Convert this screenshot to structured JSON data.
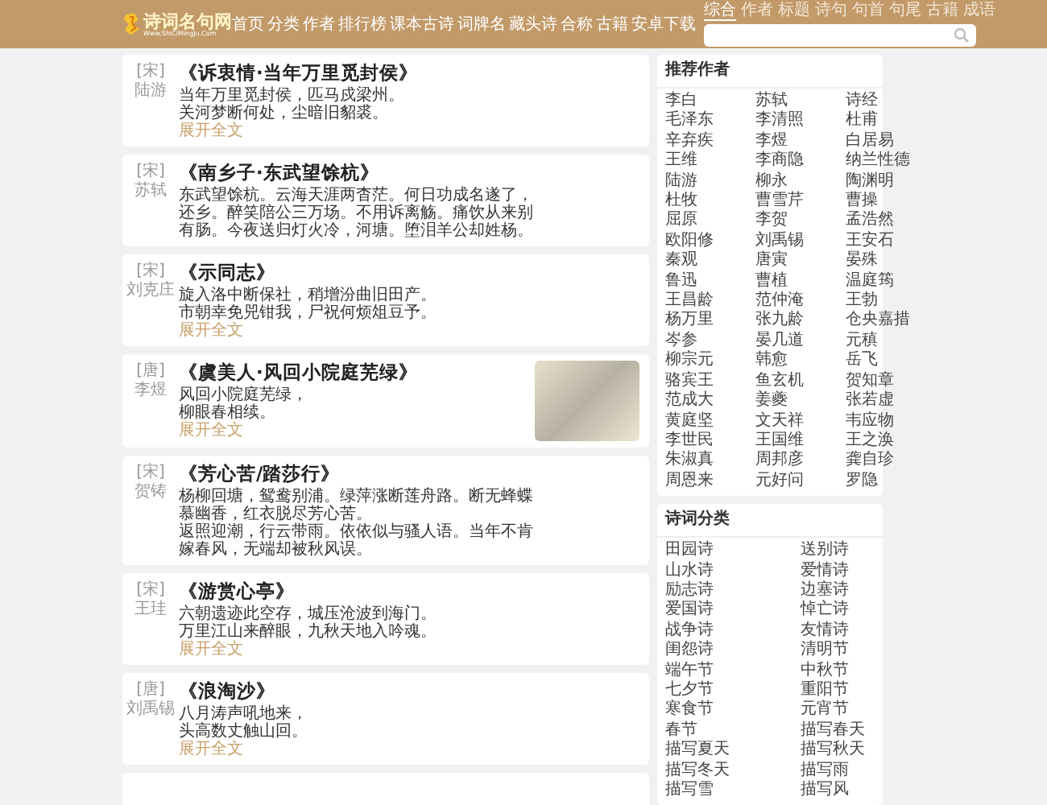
{
  "header": {
    "logo": {
      "title": "诗词名句网",
      "subtitle": "Www.ShiCiMingJu.Com"
    },
    "nav": [
      "首页",
      "分类",
      "作者",
      "排行榜",
      "课本古诗",
      "词牌名",
      "藏头诗",
      "合称",
      "古籍",
      "安卓下载"
    ],
    "search_tabs": [
      {
        "label": "综合",
        "selected": true
      },
      {
        "label": "作者",
        "selected": false
      },
      {
        "label": "标题",
        "selected": false
      },
      {
        "label": "诗句",
        "selected": false
      },
      {
        "label": "句首",
        "selected": false
      },
      {
        "label": "句尾",
        "selected": false
      },
      {
        "label": "古籍",
        "selected": false
      },
      {
        "label": "成语",
        "selected": false
      }
    ]
  },
  "poems": [
    {
      "dynasty": "[宋]",
      "author": "陆游",
      "title": "《诉衷情·当年万里觅封侯》",
      "lines": [
        "当年万里觅封侯，匹马戍梁州。",
        "关河梦断何处，尘暗旧貂裘。"
      ],
      "more": "展开全文",
      "has_image": false
    },
    {
      "dynasty": "[宋]",
      "author": "苏轼",
      "title": "《南乡子·东武望馀杭》",
      "lines": [
        "东武望馀杭。云海天涯两杳茫。何日功成名遂了，",
        "还乡。醉笑陪公三万场。不用诉离觞。痛饮从来别",
        "有肠。今夜送归灯火冷，河塘。堕泪羊公却姓杨。"
      ],
      "has_image": false
    },
    {
      "dynasty": "[宋]",
      "author": "刘克庄",
      "title": "《示同志》",
      "lines": [
        "旋入洛中断保社，稍增汾曲旧田产。",
        "市朝幸免兕钳我，尸祝何烦俎豆予。"
      ],
      "more": "展开全文",
      "has_image": false
    },
    {
      "dynasty": "[唐]",
      "author": "李煜",
      "title": "《虞美人·风回小院庭芜绿》",
      "lines": [
        "风回小院庭芜绿，",
        "柳眼春相续。"
      ],
      "more": "展开全文",
      "has_image": true
    },
    {
      "dynasty": "[宋]",
      "author": "贺铸",
      "title": "《芳心苦/踏莎行》",
      "lines": [
        "杨柳回塘，鸳鸯别浦。绿萍涨断莲舟路。断无蜂蝶",
        "慕幽香，红衣脱尽芳心苦。",
        "返照迎潮，行云带雨。依依似与骚人语。当年不肯",
        "嫁春风，无端却被秋风误。"
      ],
      "has_image": false
    },
    {
      "dynasty": "[宋]",
      "author": "王珪",
      "title": "《游赏心亭》",
      "lines": [
        "六朝遗迹此空存，城压沧波到海门。",
        "万里江山来醉眼，九秋天地入吟魂。"
      ],
      "more": "展开全文",
      "has_image": false
    },
    {
      "dynasty": "[唐]",
      "author": "刘禹锡",
      "title": "《浪淘沙》",
      "lines": [
        "八月涛声吼地来，",
        "头高数丈触山回。"
      ],
      "more": "展开全文",
      "has_image": false
    }
  ],
  "authors_panel": {
    "title": "推荐作者",
    "items": [
      "李白",
      "苏轼",
      "诗经",
      "毛泽东",
      "李清照",
      "杜甫",
      "辛弃疾",
      "李煜",
      "白居易",
      "王维",
      "李商隐",
      "纳兰性德",
      "陆游",
      "柳永",
      "陶渊明",
      "杜牧",
      "曹雪芹",
      "曹操",
      "屈原",
      "李贺",
      "孟浩然",
      "欧阳修",
      "刘禹锡",
      "王安石",
      "秦观",
      "唐寅",
      "晏殊",
      "鲁迅",
      "曹植",
      "温庭筠",
      "王昌龄",
      "范仲淹",
      "王勃",
      "杨万里",
      "张九龄",
      "仓央嘉措",
      "岑参",
      "晏几道",
      "元稹",
      "柳宗元",
      "韩愈",
      "岳飞",
      "骆宾王",
      "鱼玄机",
      "贺知章",
      "范成大",
      "姜夔",
      "张若虚",
      "黄庭坚",
      "文天祥",
      "韦应物",
      "李世民",
      "王国维",
      "王之涣",
      "朱淑真",
      "周邦彦",
      "龚自珍",
      "周恩来",
      "元好问",
      "罗隐"
    ]
  },
  "categories_panel": {
    "title": "诗词分类",
    "items": [
      "田园诗",
      "送别诗",
      "山水诗",
      "爱情诗",
      "励志诗",
      "边塞诗",
      "爱国诗",
      "悼亡诗",
      "战争诗",
      "友情诗",
      "闺怨诗",
      "清明节",
      "端午节",
      "中秋节",
      "七夕节",
      "重阳节",
      "寒食节",
      "元宵节",
      "春节",
      "描写春天",
      "描写夏天",
      "描写秋天",
      "描写冬天",
      "描写雨",
      "描写雪",
      "描写风"
    ]
  }
}
